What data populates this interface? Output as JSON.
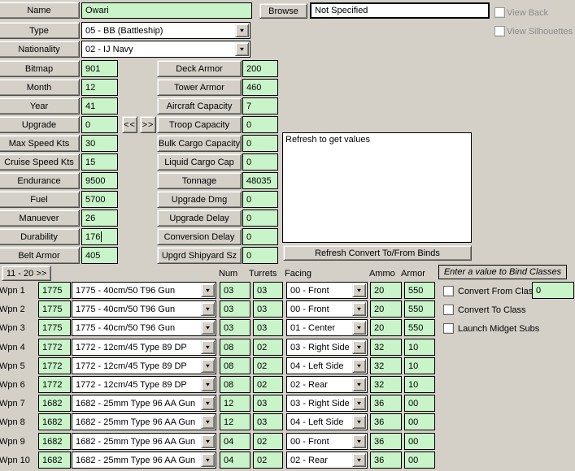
{
  "colors": {
    "background": "#d4d0c8",
    "field_green": "#c9f4c9",
    "field_white": "#ffffff",
    "disabled_text": "#8a8a8a"
  },
  "icons": {
    "dropdown_arrow": "▼"
  },
  "header": {
    "name_label": "Name",
    "name_value": "Owari",
    "browse_button": "Browse",
    "path_value": "Not Specified",
    "view_back_label": "View Back",
    "view_back_checked": false,
    "view_silhouettes_label": "View Silhouettes",
    "view_silhouettes_checked": false,
    "type_label": "Type",
    "type_value": "05 - BB (Battleship)",
    "nationality_label": "Nationality",
    "nationality_value": "02 - IJ Navy"
  },
  "stepper": {
    "prev": "<<",
    "next": ">>"
  },
  "left_fields": [
    {
      "label": "Bitmap",
      "value": "901"
    },
    {
      "label": "Month",
      "value": "12"
    },
    {
      "label": "Year",
      "value": "41"
    },
    {
      "label": "Upgrade",
      "value": "0",
      "steppers": true
    },
    {
      "label": "Max Speed Kts",
      "value": "30"
    },
    {
      "label": "Cruise Speed Kts",
      "value": "15"
    },
    {
      "label": "Endurance",
      "value": "9500"
    },
    {
      "label": "Fuel",
      "value": "5700"
    },
    {
      "label": "Manuever",
      "value": "26"
    },
    {
      "label": "Durability",
      "value": "176",
      "caret": true
    },
    {
      "label": "Belt Armor",
      "value": "405"
    }
  ],
  "middle_fields": [
    {
      "label": "Deck Armor",
      "value": "200"
    },
    {
      "label": "Tower Armor",
      "value": "460"
    },
    {
      "label": "Aircraft Capacity",
      "value": "7"
    },
    {
      "label": "Troop Capacity",
      "value": "0"
    },
    {
      "label": "Bulk Cargo Capacity",
      "value": "0"
    },
    {
      "label": "Liquid Cargo Cap",
      "value": "0"
    },
    {
      "label": "Tonnage",
      "value": "48035"
    },
    {
      "label": "Upgrade Dmg",
      "value": "0"
    },
    {
      "label": "Upgrade Delay",
      "value": "0"
    },
    {
      "label": "Conversion Delay",
      "value": "0"
    },
    {
      "label": "Upgrd Shipyard Sz",
      "value": "0"
    }
  ],
  "binds_panel": {
    "textarea_text": "Refresh to get values",
    "refresh_button": "Refresh Convert To/From Binds"
  },
  "weapons": {
    "pager_button": "11 - 20 >>",
    "columns": {
      "num": "Num",
      "turrets": "Turrets",
      "facing": "Facing",
      "ammo": "Ammo",
      "armor": "Armor"
    },
    "rows": [
      {
        "label": "Wpn 1",
        "id": "1775",
        "weapon": "1775 - 40cm/50 T96 Gun",
        "num": "03",
        "turrets": "03",
        "facing": "00 - Front",
        "ammo": "20",
        "armor": "550"
      },
      {
        "label": "Wpn 2",
        "id": "1775",
        "weapon": "1775 - 40cm/50 T96 Gun",
        "num": "03",
        "turrets": "03",
        "facing": "00 - Front",
        "ammo": "20",
        "armor": "550"
      },
      {
        "label": "Wpn 3",
        "id": "1775",
        "weapon": "1775 - 40cm/50 T96 Gun",
        "num": "03",
        "turrets": "03",
        "facing": "01 - Center",
        "ammo": "20",
        "armor": "550"
      },
      {
        "label": "Wpn 4",
        "id": "1772",
        "weapon": "1772 - 12cm/45 Type 89 DP",
        "num": "08",
        "turrets": "02",
        "facing": "03 - Right Side",
        "ammo": "32",
        "armor": "10"
      },
      {
        "label": "Wpn 5",
        "id": "1772",
        "weapon": "1772 - 12cm/45 Type 89 DP",
        "num": "08",
        "turrets": "02",
        "facing": "04 - Left Side",
        "ammo": "32",
        "armor": "10"
      },
      {
        "label": "Wpn 6",
        "id": "1772",
        "weapon": "1772 - 12cm/45 Type 89 DP",
        "num": "08",
        "turrets": "02",
        "facing": "02 - Rear",
        "ammo": "32",
        "armor": "10"
      },
      {
        "label": "Wpn 7",
        "id": "1682",
        "weapon": "1682 - 25mm Type 96 AA Gun",
        "num": "12",
        "turrets": "03",
        "facing": "03 - Right Side",
        "ammo": "36",
        "armor": "00"
      },
      {
        "label": "Wpn 8",
        "id": "1682",
        "weapon": "1682 - 25mm Type 96 AA Gun",
        "num": "12",
        "turrets": "03",
        "facing": "04 - Left Side",
        "ammo": "36",
        "armor": "00"
      },
      {
        "label": "Wpn 9",
        "id": "1682",
        "weapon": "1682 - 25mm Type 96 AA Gun",
        "num": "04",
        "turrets": "02",
        "facing": "00 - Front",
        "ammo": "36",
        "armor": "00"
      },
      {
        "label": "Wpn 10",
        "id": "1682",
        "weapon": "1682 - 25mm Type 96 AA Gun",
        "num": "04",
        "turrets": "02",
        "facing": "02 - Rear",
        "ammo": "36",
        "armor": "00"
      }
    ]
  },
  "bind_classes": {
    "title": "Enter a value to Bind Classes",
    "convert_from_label": "Convert From Class",
    "convert_from_value": "0",
    "convert_from_checked": false,
    "convert_to_label": "Convert To Class",
    "convert_to_checked": false,
    "launch_midget_subs_label": "Launch Midget Subs",
    "launch_midget_subs_checked": false
  }
}
